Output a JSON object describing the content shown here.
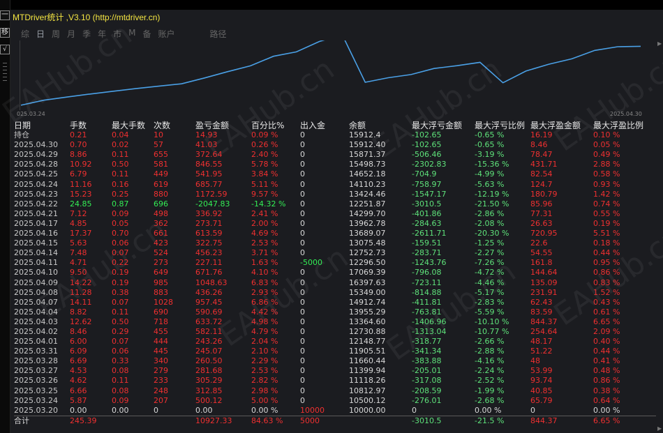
{
  "title": "MTDriver统计 ,V3.10 (http://mtdriver.cn)",
  "left_buttons": [
    "一",
    "移",
    "√"
  ],
  "tabs": [
    {
      "label": "综",
      "active": false
    },
    {
      "label": "日",
      "active": true
    },
    {
      "label": "周",
      "active": false
    },
    {
      "label": "月",
      "active": false
    },
    {
      "label": "季",
      "active": false
    },
    {
      "label": "年",
      "active": false
    },
    {
      "label": "市",
      "active": false
    },
    {
      "label": "M",
      "active": false
    },
    {
      "label": "备",
      "active": false
    },
    {
      "label": "账户",
      "active": false
    },
    {
      "label": "路径",
      "active": false,
      "path": true
    }
  ],
  "watermark": "EAHub.cn",
  "chart_data": {
    "type": "line",
    "x_start": "025.03.24",
    "x_end": "2025.04.30",
    "x": [
      "2025.03.20",
      "2025.03.24",
      "2025.03.25",
      "2025.03.26",
      "2025.03.27",
      "2025.03.28",
      "2025.03.31",
      "2025.04.01",
      "2025.04.02",
      "2025.04.03",
      "2025.04.04",
      "2025.04.07",
      "2025.04.08",
      "2025.04.09",
      "2025.04.10",
      "2025.04.11",
      "2025.04.14",
      "2025.04.15",
      "2025.04.16",
      "2025.04.17",
      "2025.04.21",
      "2025.04.22",
      "2025.04.23",
      "2025.04.24",
      "2025.04.25",
      "2025.04.28",
      "2025.04.29",
      "2025.04.30"
    ],
    "series": [
      {
        "values": [
          10000.0,
          10500.12,
          10812.97,
          11118.26,
          11399.94,
          11660.44,
          11905.51,
          12148.77,
          12730.88,
          13364.6,
          13955.29,
          14912.74,
          15349.0,
          16397.63,
          17069.39,
          12296.5,
          12752.73,
          13075.48,
          13689.07,
          13962.78,
          14299.7,
          12251.87,
          13424.46,
          14110.23,
          14652.18,
          15498.73,
          15871.37,
          15912.4
        ],
        "color": "#4aa0e6"
      }
    ],
    "ylim": [
      9500,
      16500
    ]
  },
  "columns": [
    "日期",
    "手数",
    "最大手数",
    "次数",
    "盈亏金额",
    "百分比%",
    "出入金",
    "余额",
    "最大浮亏金额",
    "最大浮亏比例",
    "最大浮盈金额",
    "最大浮盈比例"
  ],
  "rows": [
    [
      "持仓",
      "0.21",
      "0.04",
      "10",
      "14.93",
      "0.09 %",
      "0",
      "15912.4",
      "-102.65",
      "-0.65 %",
      "16.19",
      "0.10 %"
    ],
    [
      "2025.04.30",
      "0.70",
      "0.02",
      "57",
      "41.03",
      "0.26 %",
      "0",
      "15912.40",
      "-102.65",
      "-0.65 %",
      "8.46",
      "0.05 %"
    ],
    [
      "2025.04.29",
      "8.86",
      "0.11",
      "655",
      "372.64",
      "2.40 %",
      "0",
      "15871.37",
      "-506.46",
      "-3.19 %",
      "78.47",
      "0.49 %"
    ],
    [
      "2025.04.28",
      "10.92",
      "0.50",
      "581",
      "846.55",
      "5.78 %",
      "0",
      "15498.73",
      "-2302.83",
      "-15.36 %",
      "431.71",
      "2.88 %"
    ],
    [
      "2025.04.25",
      "6.79",
      "0.11",
      "449",
      "541.95",
      "3.84 %",
      "0",
      "14652.18",
      "-704.9",
      "-4.99 %",
      "82.54",
      "0.58 %"
    ],
    [
      "2025.04.24",
      "11.16",
      "0.16",
      "619",
      "685.77",
      "5.11 %",
      "0",
      "14110.23",
      "-758.97",
      "-5.63 %",
      "124.7",
      "0.93 %"
    ],
    [
      "2025.04.23",
      "15.23",
      "0.25",
      "880",
      "1172.59",
      "9.57 %",
      "0",
      "13424.46",
      "-1547.17",
      "-12.19 %",
      "180.79",
      "1.42 %"
    ],
    [
      "2025.04.22",
      "24.85",
      "0.87",
      "696",
      "-2047.83",
      "-14.32 %",
      "0",
      "12251.87",
      "-3010.5",
      "-21.50 %",
      "85.96",
      "0.74 %"
    ],
    [
      "2025.04.21",
      "7.12",
      "0.09",
      "498",
      "336.92",
      "2.41 %",
      "0",
      "14299.70",
      "-401.86",
      "-2.86 %",
      "77.31",
      "0.55 %"
    ],
    [
      "2025.04.17",
      "4.85",
      "0.05",
      "362",
      "273.71",
      "2.00 %",
      "0",
      "13962.78",
      "-284.63",
      "-2.08 %",
      "26.63",
      "0.19 %"
    ],
    [
      "2025.04.16",
      "17.37",
      "0.70",
      "661",
      "613.59",
      "4.69 %",
      "0",
      "13689.07",
      "-2611.71",
      "-20.30 %",
      "720.95",
      "5.51 %"
    ],
    [
      "2025.04.15",
      "5.63",
      "0.06",
      "423",
      "322.75",
      "2.53 %",
      "0",
      "13075.48",
      "-159.51",
      "-1.25 %",
      "22.6",
      "0.18 %"
    ],
    [
      "2025.04.14",
      "7.48",
      "0.07",
      "524",
      "456.23",
      "3.71 %",
      "0",
      "12752.73",
      "-283.71",
      "-2.27 %",
      "54.55",
      "0.44 %"
    ],
    [
      "2025.04.11",
      "4.71",
      "0.22",
      "273",
      "227.11",
      "1.63 %",
      "-5000",
      "12296.50",
      "-1243.76",
      "-7.26 %",
      "161.8",
      "0.95 %"
    ],
    [
      "2025.04.10",
      "9.50",
      "0.19",
      "649",
      "671.76",
      "4.10 %",
      "0",
      "17069.39",
      "-796.08",
      "-4.72 %",
      "144.64",
      "0.86 %"
    ],
    [
      "2025.04.09",
      "14.22",
      "0.19",
      "985",
      "1048.63",
      "6.83 %",
      "0",
      "16397.63",
      "-723.11",
      "-4.46 %",
      "135.09",
      "0.83 %"
    ],
    [
      "2025.04.08",
      "11.28",
      "0.38",
      "883",
      "436.26",
      "2.93 %",
      "0",
      "15349.00",
      "-814.88",
      "-5.17 %",
      "231.91",
      "1.52 %"
    ],
    [
      "2025.04.07",
      "14.11",
      "0.07",
      "1028",
      "957.45",
      "6.86 %",
      "0",
      "14912.74",
      "-411.81",
      "-2.83 %",
      "62.43",
      "0.43 %"
    ],
    [
      "2025.04.04",
      "8.82",
      "0.11",
      "690",
      "590.69",
      "4.42 %",
      "0",
      "13955.29",
      "-763.81",
      "-5.59 %",
      "83.59",
      "0.61 %"
    ],
    [
      "2025.04.03",
      "12.62",
      "0.50",
      "718",
      "633.72",
      "4.98 %",
      "0",
      "13364.60",
      "-1406.96",
      "-10.10 %",
      "844.37",
      "6.65 %"
    ],
    [
      "2025.04.02",
      "8.46",
      "0.29",
      "455",
      "582.11",
      "4.79 %",
      "0",
      "12730.88",
      "-1313.04",
      "-10.77 %",
      "254.64",
      "2.09 %"
    ],
    [
      "2025.04.01",
      "6.00",
      "0.07",
      "444",
      "243.26",
      "2.04 %",
      "0",
      "12148.77",
      "-318.77",
      "-2.66 %",
      "48.17",
      "0.40 %"
    ],
    [
      "2025.03.31",
      "6.09",
      "0.06",
      "445",
      "245.07",
      "2.10 %",
      "0",
      "11905.51",
      "-341.34",
      "-2.88 %",
      "51.22",
      "0.44 %"
    ],
    [
      "2025.03.28",
      "6.69",
      "0.33",
      "340",
      "260.50",
      "2.29 %",
      "0",
      "11660.44",
      "-383.88",
      "-4.16 %",
      "48",
      "0.41 %"
    ],
    [
      "2025.03.27",
      "4.53",
      "0.08",
      "279",
      "281.68",
      "2.53 %",
      "0",
      "11399.94",
      "-205.01",
      "-2.24 %",
      "53.99",
      "0.48 %"
    ],
    [
      "2025.03.26",
      "4.62",
      "0.11",
      "233",
      "305.29",
      "2.82 %",
      "0",
      "11118.26",
      "-317.08",
      "-2.52 %",
      "93.74",
      "0.86 %"
    ],
    [
      "2025.03.25",
      "6.66",
      "0.08",
      "248",
      "312.85",
      "2.98 %",
      "0",
      "10812.97",
      "-208.59",
      "-1.99 %",
      "40.85",
      "0.38 %"
    ],
    [
      "2025.03.24",
      "5.87",
      "0.09",
      "207",
      "500.12",
      "5.00 %",
      "0",
      "10500.12",
      "-276.01",
      "-2.68 %",
      "65.79",
      "0.64 %"
    ],
    [
      "2025.03.20",
      "0.00",
      "0.00",
      "0",
      "0.00",
      "0.00 %",
      "10000",
      "10000.00",
      "0",
      "0.00 %",
      "0",
      "0.00 %"
    ]
  ],
  "total": [
    "合计",
    "245.39",
    "",
    "",
    "10927.33",
    "84.63 %",
    "5000",
    "",
    "-3010.5",
    "-21.5 %",
    "844.37",
    "6.65 %"
  ],
  "colors": {
    "title": "#f5e642",
    "profit": "#f03030",
    "loss": "#33ee55",
    "line": "#4aa0e6",
    "panel": "#1b1c20"
  }
}
